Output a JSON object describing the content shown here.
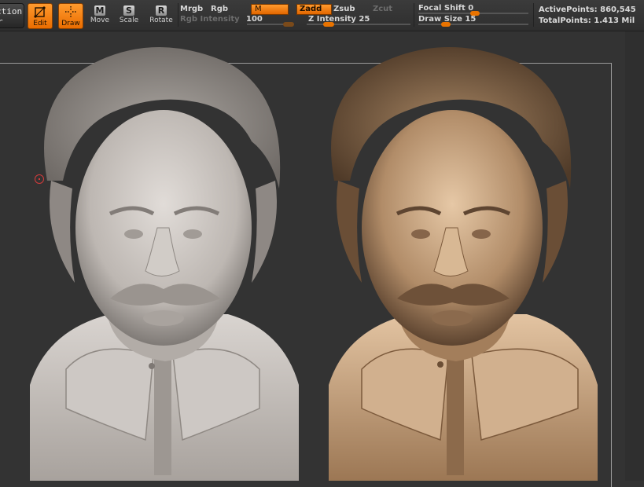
{
  "toolbar": {
    "action_label_line1": "ction",
    "action_label_line2": "r",
    "edit_label": "Edit",
    "draw_label": "Draw",
    "move_letter": "M",
    "move_label": "Move",
    "scale_letter": "S",
    "scale_label": "Scale",
    "rotate_letter": "R",
    "rotate_label": "Rotate"
  },
  "color": {
    "mrgb_label": "Mrgb",
    "rgb_label": "Rgb",
    "m_label": "M",
    "rgb_intensity_label": "Rgb  Intensity",
    "rgb_intensity_value": "100"
  },
  "depth": {
    "zadd_label": "Zadd",
    "zsub_label": "Zsub",
    "zcut_label": "Zcut",
    "z_intensity_text": "Z Intensity 25",
    "z_intensity_value": 25
  },
  "brush": {
    "focal_shift_text": "Focal Shift 0",
    "focal_shift_value": 0,
    "draw_size_text": "Draw Size 15",
    "draw_size_value": 15
  },
  "stats": {
    "active_points_text": "ActivePoints: 860,545",
    "total_points_text": "TotalPoints: 1.413 Mil"
  },
  "colors": {
    "accent": "#ef7a10",
    "canvas_bg": "#333333",
    "clay_grey": "#c9c4c0",
    "clay_bronze": "#b48e6b"
  }
}
